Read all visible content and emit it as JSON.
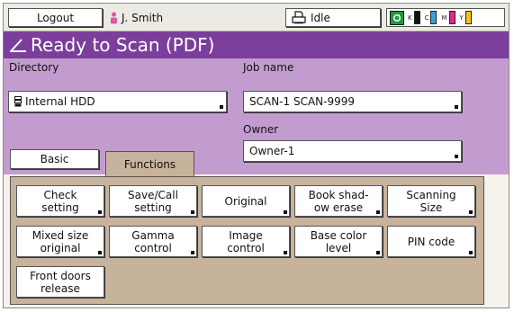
{
  "topbar": {
    "logout_label": "Logout",
    "user_name": "J. Smith",
    "status_text": "Idle",
    "toners": [
      {
        "letter": "K",
        "color": "#111111"
      },
      {
        "letter": "C",
        "color": "#29a8e0"
      },
      {
        "letter": "M",
        "color": "#e0288f"
      },
      {
        "letter": "Y",
        "color": "#f2c41a"
      }
    ]
  },
  "title": "Ready to Scan (PDF)",
  "settings": {
    "directory_label": "Directory",
    "directory_value": "Internal HDD",
    "job_name_label": "Job name",
    "job_name_value": "SCAN-1 SCAN-9999",
    "owner_label": "Owner",
    "owner_value": "Owner-1"
  },
  "tabs": {
    "basic": "Basic",
    "functions": "Functions"
  },
  "functions": {
    "check_setting": [
      "Check",
      "setting"
    ],
    "save_call_setting": [
      "Save/Call",
      "setting"
    ],
    "original": [
      "Original"
    ],
    "book_shadow_erase": [
      "Book shad-",
      "ow erase"
    ],
    "scanning_size": [
      "Scanning",
      "Size"
    ],
    "mixed_size_original": [
      "Mixed size",
      "original"
    ],
    "gamma_control": [
      "Gamma",
      "control"
    ],
    "image_control": [
      "Image",
      "control"
    ],
    "base_color_level": [
      "Base color",
      "level"
    ],
    "pin_code": [
      "PIN code"
    ],
    "front_doors_release": [
      "Front doors",
      "release"
    ]
  },
  "colors": {
    "title_bar": "#7b3f9b",
    "settings_bg": "#c39ccf",
    "panel_bg": "#c7b29c"
  }
}
